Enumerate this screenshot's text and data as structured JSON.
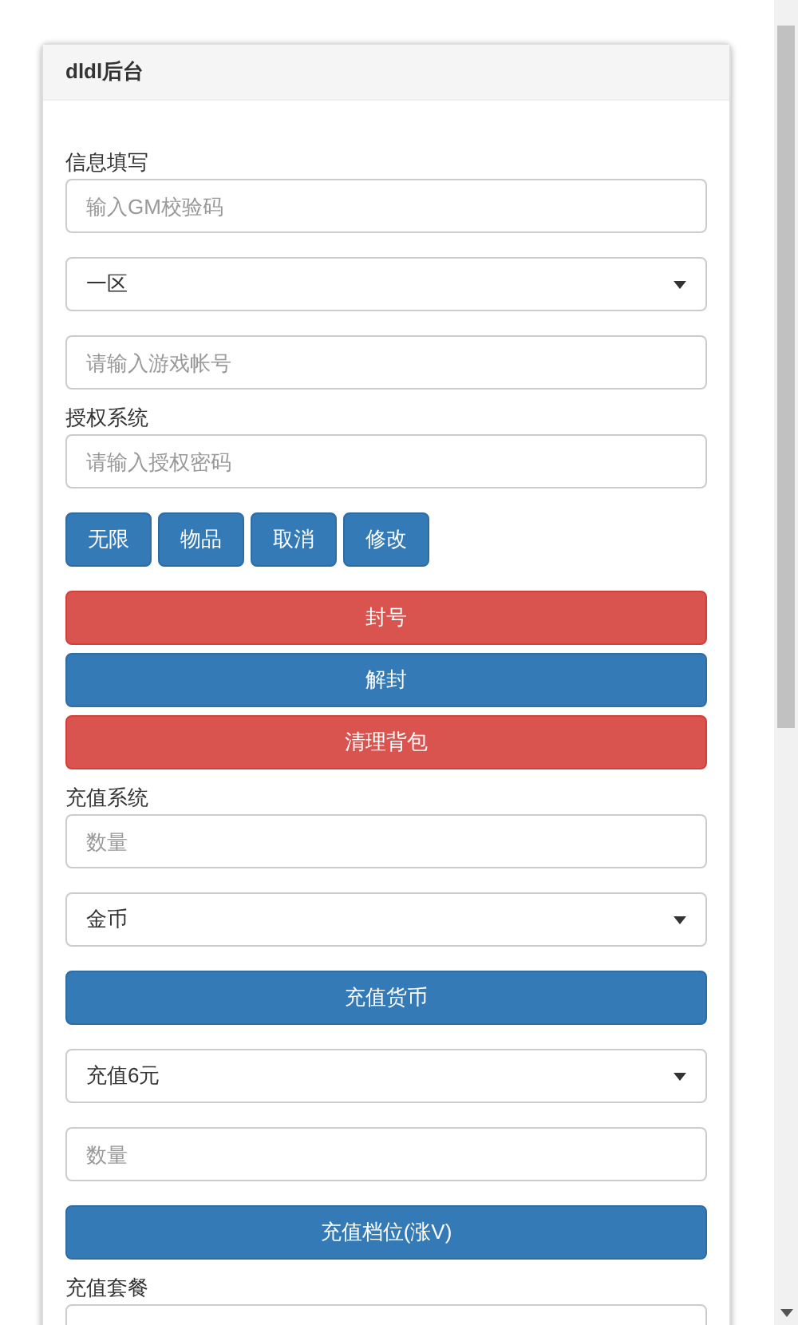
{
  "panel": {
    "title": "dldl后台"
  },
  "items": [
    {
      "kind": "label",
      "text": "信息填写"
    },
    {
      "kind": "input",
      "placeholder": "输入GM校验码"
    },
    {
      "kind": "select",
      "value": "一区"
    },
    {
      "kind": "input",
      "placeholder": "请输入游戏帐号"
    },
    {
      "kind": "label",
      "text": "授权系统"
    },
    {
      "kind": "input",
      "placeholder": "请输入授权密码"
    },
    {
      "kind": "buttons",
      "labels": [
        "无限",
        "物品",
        "取消",
        "修改"
      ]
    },
    {
      "kind": "danger",
      "label": "封号"
    },
    {
      "kind": "button",
      "label": "解封"
    },
    {
      "kind": "danger",
      "label": "清理背包"
    },
    {
      "kind": "label",
      "text": "充值系统"
    },
    {
      "kind": "input",
      "placeholder": "数量"
    },
    {
      "kind": "select",
      "value": "金币"
    },
    {
      "kind": "button",
      "label": "充值货币"
    },
    {
      "kind": "select",
      "value": "充值6元"
    },
    {
      "kind": "input",
      "placeholder": "数量"
    },
    {
      "kind": "button",
      "label": "充值档位(涨V)"
    },
    {
      "kind": "label",
      "text": "充值套餐"
    },
    {
      "kind": "input"
    }
  ]
}
